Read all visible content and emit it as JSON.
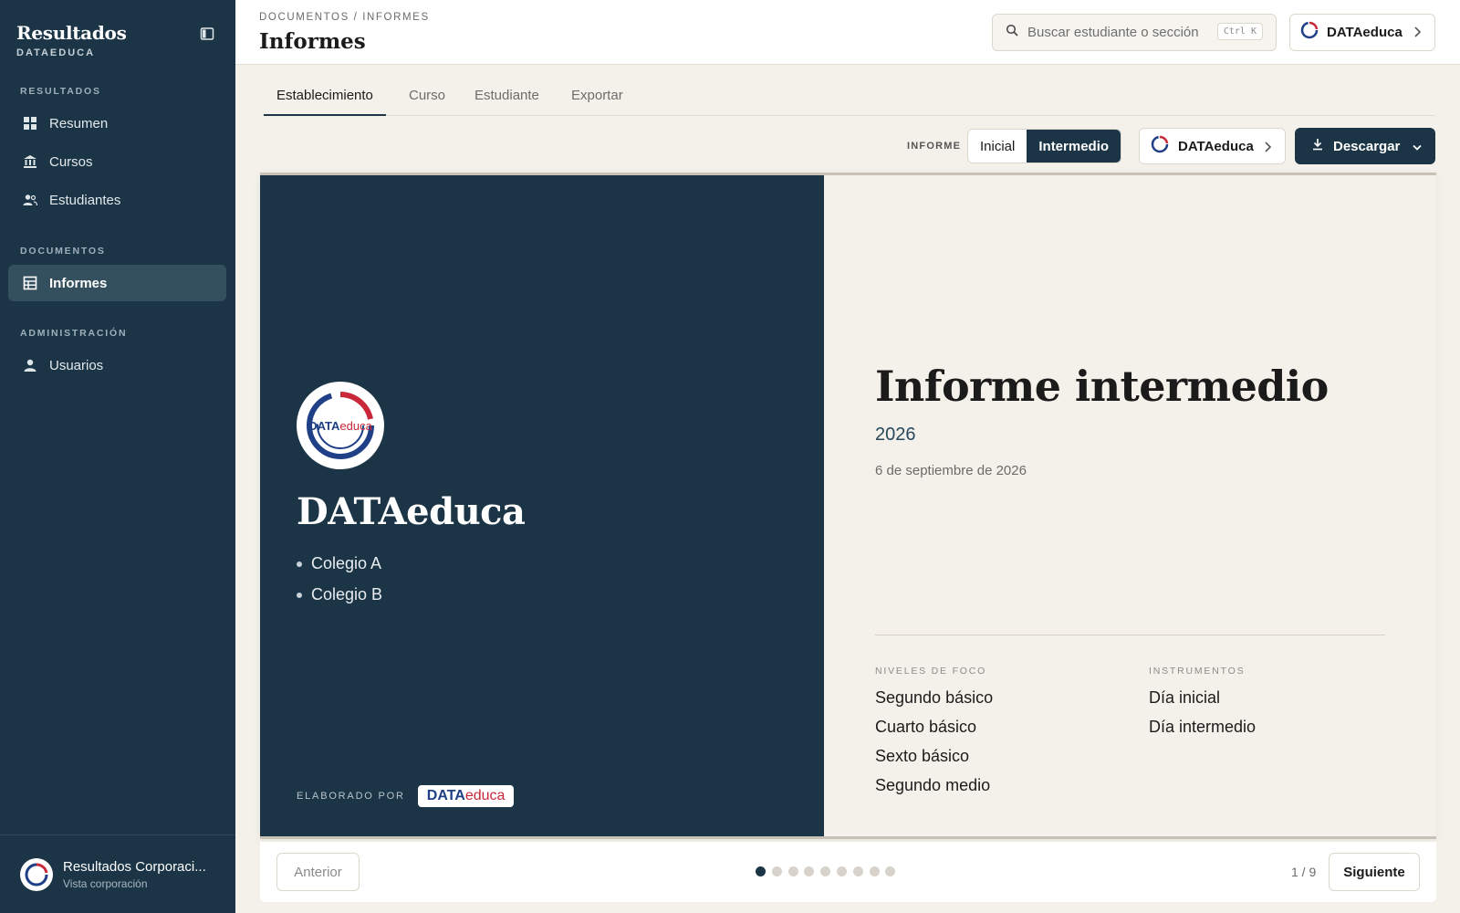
{
  "sidebar": {
    "title": "Resultados",
    "subtitle": "DATAEDUCA",
    "sections": [
      {
        "label": "RESULTADOS"
      },
      {
        "label": "DOCUMENTOS"
      },
      {
        "label": "ADMINISTRACIÓN"
      }
    ],
    "items": [
      {
        "label": "Resumen",
        "icon": "grid-icon"
      },
      {
        "label": "Cursos",
        "icon": "building-icon"
      },
      {
        "label": "Estudiantes",
        "icon": "users-icon"
      },
      {
        "label": "Informes",
        "icon": "table-icon",
        "active": true
      },
      {
        "label": "Usuarios",
        "icon": "user-icon"
      }
    ],
    "footer": {
      "name": "Resultados Corporaci...",
      "sub": "Vista corporación"
    }
  },
  "header": {
    "breadcrumb": "DOCUMENTOS / INFORMES",
    "title": "Informes",
    "search_placeholder": "Buscar estudiante o sección",
    "shortcut": "Ctrl K",
    "org_name": "DATAeduca"
  },
  "tabs": [
    {
      "label": "Establecimiento",
      "active": true
    },
    {
      "label": "Curso"
    },
    {
      "label": "Estudiante"
    },
    {
      "label": "Exportar"
    }
  ],
  "toolbar": {
    "label": "INFORME",
    "options": [
      {
        "label": "Inicial"
      },
      {
        "label": "Intermedio",
        "active": true
      }
    ],
    "org_name": "DATAeduca",
    "download_label": "Descargar"
  },
  "report": {
    "logo_text_a": "DATA",
    "logo_text_b": "educa",
    "school_name": "DATAeduca",
    "schools": [
      "Colegio A",
      "Colegio B"
    ],
    "made_by_label": "ELABORADO POR",
    "title": "Informe intermedio",
    "year": "2026",
    "date": "6 de septiembre de 2026",
    "levels_head": "NIVELES DE FOCO",
    "levels": [
      "Segundo básico",
      "Cuarto básico",
      "Sexto básico",
      "Segundo medio"
    ],
    "instruments_head": "INSTRUMENTOS",
    "instruments": [
      "Día inicial",
      "Día intermedio"
    ]
  },
  "pager": {
    "prev": "Anterior",
    "next": "Siguiente",
    "count": "1 / 9",
    "total": 9,
    "current": 1
  },
  "colors": {
    "navy": "#1b3547",
    "brand_blue": "#1f3f86",
    "brand_red": "#c8283a",
    "bg": "#f4f1ea"
  }
}
